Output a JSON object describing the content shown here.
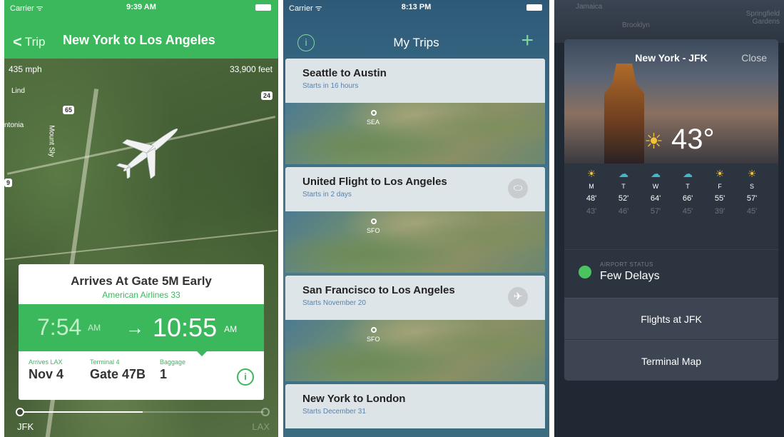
{
  "screen1": {
    "status": {
      "carrier": "Carrier ᯤ",
      "time": "9:39 AM"
    },
    "nav": {
      "back_label": "Trip",
      "title": "New York to Los Angeles"
    },
    "map": {
      "speed": "435 mph",
      "altitude": "33,900 feet",
      "labels": [
        "Lind",
        "ntonia",
        "Mount Sly"
      ],
      "shields": [
        "65",
        "24",
        "9"
      ]
    },
    "card": {
      "title": "Arrives At Gate 5M Early",
      "airline": "American Airlines 33",
      "depart_time": "7:54",
      "depart_ampm": "AM",
      "arrive_time": "10:55",
      "arrive_ampm": "AM",
      "arrow": "→",
      "details": [
        {
          "label": "Arrives LAX",
          "value": "Nov 4"
        },
        {
          "label": "Terminal 4",
          "value": "Gate 47B"
        },
        {
          "label": "Baggage",
          "value": "1"
        }
      ],
      "info_glyph": "i"
    },
    "progress": {
      "fraction": 0.5,
      "from": "JFK",
      "to": "LAX"
    }
  },
  "screen2": {
    "status": {
      "carrier": "Carrier ᯤ",
      "time": "8:13 PM"
    },
    "header": {
      "title": "My Trips",
      "info_glyph": "i",
      "add_glyph": "+"
    },
    "trips": [
      {
        "name": "Seattle to Austin",
        "sub": "Starts in 16 hours",
        "code": "SEA",
        "icon": ""
      },
      {
        "name": "United Flight to Los Angeles",
        "sub": "Starts in 2 days",
        "code": "SFO",
        "icon": "⬭"
      },
      {
        "name": "San Francisco to Los Angeles",
        "sub": "Starts November 20",
        "code": "SFO",
        "icon": "✈"
      },
      {
        "name": "New York to London",
        "sub": "Starts December 31",
        "code": "",
        "icon": ""
      }
    ]
  },
  "screen3": {
    "background_labels": [
      "Brooklyn",
      "Springfield Gardens",
      "Jamaica"
    ],
    "header": {
      "title": "New York - JFK",
      "close_label": "Close"
    },
    "weather": {
      "current_temp": "43°",
      "sun_glyph": "☀"
    },
    "forecast": [
      {
        "day": "M",
        "hi": "48'",
        "lo": "43'",
        "icon": "☀",
        "color": "#f4c13a"
      },
      {
        "day": "T",
        "hi": "52'",
        "lo": "46'",
        "icon": "☁",
        "color": "#3fb8c8"
      },
      {
        "day": "W",
        "hi": "64'",
        "lo": "57'",
        "icon": "☁",
        "color": "#3fb8c8"
      },
      {
        "day": "T",
        "hi": "66'",
        "lo": "45'",
        "icon": "☁",
        "color": "#3fb8c8"
      },
      {
        "day": "F",
        "hi": "55'",
        "lo": "39'",
        "icon": "☀",
        "color": "#f4c13a"
      },
      {
        "day": "S",
        "hi": "57'",
        "lo": "45'",
        "icon": "☀",
        "color": "#f4c13a"
      }
    ],
    "airport_status": {
      "label": "AIRPORT STATUS",
      "value": "Few Delays",
      "color": "#4bc460"
    },
    "actions": [
      "Flights at JFK",
      "Terminal Map"
    ]
  }
}
